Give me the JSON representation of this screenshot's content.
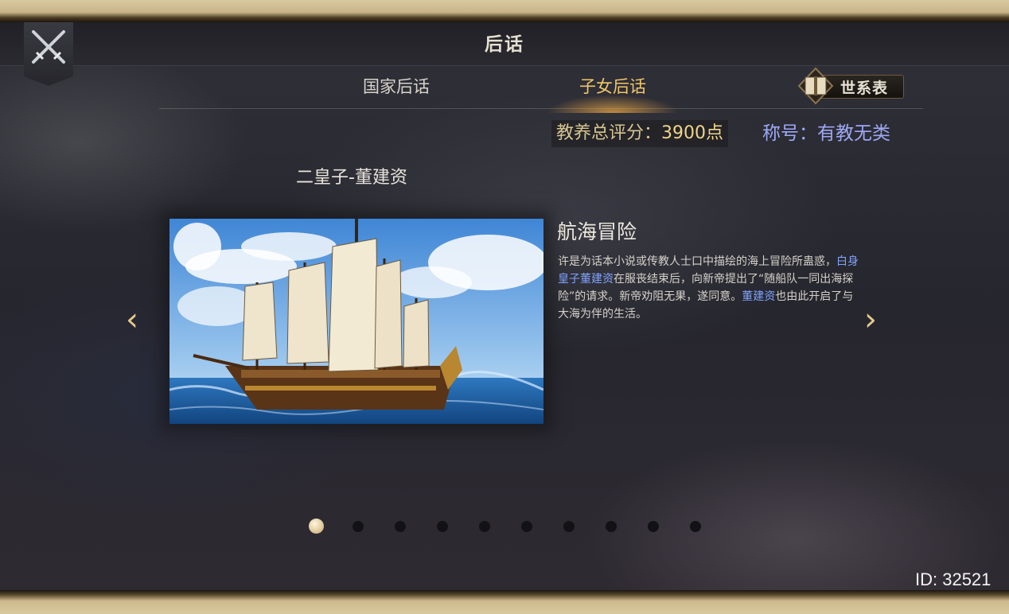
{
  "header": {
    "title": "后话"
  },
  "tabs": [
    {
      "label": "国家后话",
      "active": false
    },
    {
      "label": "子女后话",
      "active": true
    }
  ],
  "lineage_button": {
    "label": "世系表"
  },
  "score": {
    "label": "教养总评分：",
    "value": "3900点"
  },
  "title_info": "称号：有教无类",
  "child_name": "二皇子-董建资",
  "story": {
    "heading": "航海冒险",
    "body_part1": "许是为话本小说或传教人士口中描绘的海上冒险所蛊惑，",
    "body_highlight1": "白身皇子董建资",
    "body_part2": "在服丧结束后，向新帝提出了“随船队一同出海探险”的请求。新帝劝阻无果，遂同意。",
    "body_highlight2": "董建资",
    "body_part3": "也由此开启了与大海为伴的生活。"
  },
  "nav": {
    "prev_icon": "‹",
    "next_icon": "›"
  },
  "pager": {
    "total": 10,
    "current": 1
  },
  "footer": {
    "id_text": "ID: 32521"
  },
  "colors": {
    "active_tab": "#f1c66a",
    "highlight_text": "#7fa3ff",
    "title_text": "#9ea8f5"
  }
}
